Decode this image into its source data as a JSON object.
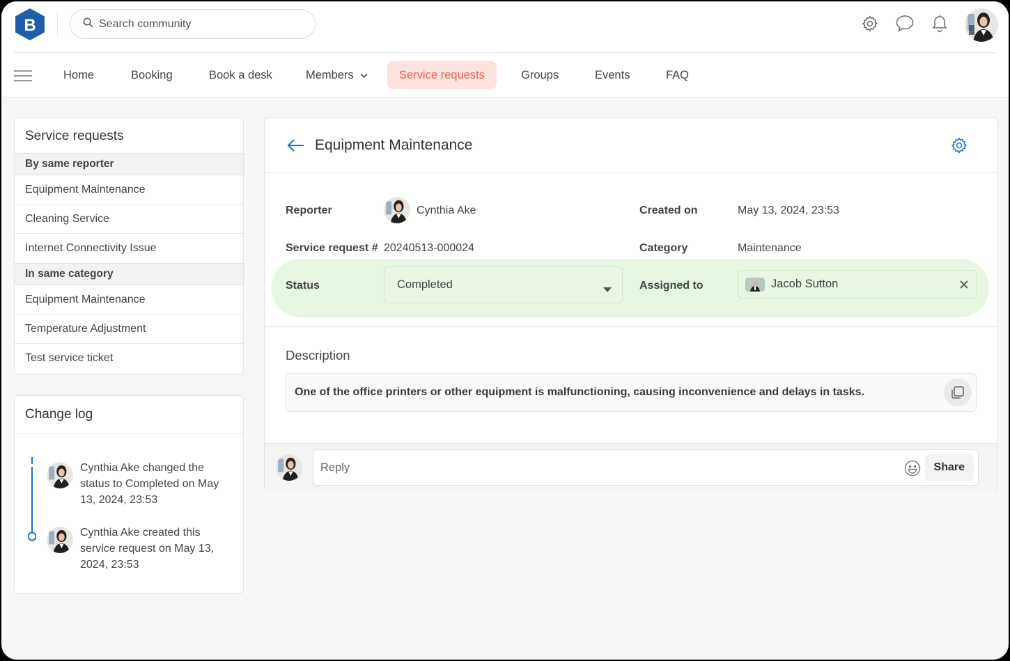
{
  "header": {
    "logo_letter": "B",
    "search_placeholder": "Search community",
    "icons": [
      "gear-icon",
      "chat-icon",
      "bell-icon"
    ]
  },
  "nav": {
    "items": [
      {
        "label": "Home"
      },
      {
        "label": "Booking"
      },
      {
        "label": "Book a desk"
      },
      {
        "label": "Members"
      },
      {
        "label": "Service requests",
        "active": true
      },
      {
        "label": "Groups"
      },
      {
        "label": "Events"
      },
      {
        "label": "FAQ"
      }
    ]
  },
  "sidebar": {
    "title": "Service requests",
    "group1": {
      "header": "By same reporter",
      "items": [
        "Equipment Maintenance",
        "Cleaning Service",
        "Internet Connectivity Issue"
      ]
    },
    "group2": {
      "header": "In same category",
      "items": [
        "Equipment Maintenance",
        "Temperature Adjustment",
        "Test service ticket"
      ]
    }
  },
  "changelog": {
    "title": "Change log",
    "entries": [
      "Cynthia Ake changed the status to Completed on May 13, 2024, 23:53",
      "Cynthia Ake created this service request on May 13, 2024, 23:53"
    ]
  },
  "detail": {
    "title": "Equipment Maintenance",
    "reporter_label": "Reporter",
    "reporter_name": "Cynthia Ake",
    "created_label": "Created on",
    "created_value": "May 13, 2024, 23:53",
    "request_label": "Service request #",
    "request_value": "20240513-000024",
    "category_label": "Category",
    "category_value": "Maintenance",
    "status_label": "Status",
    "status_value": "Completed",
    "assigned_label": "Assigned to",
    "assigned_value": "Jacob Sutton",
    "description_label": "Description",
    "description_text": "One of the office printers or other equipment is malfunctioning, causing inconvenience and delays in tasks."
  },
  "reply": {
    "placeholder": "Reply",
    "share_label": "Share"
  },
  "colors": {
    "brand": "#1e5fa8",
    "active_nav_bg": "#fde2de",
    "active_nav_text": "#e8614f",
    "status_band": "#e7f6e2",
    "timeline": "#1e6fd0"
  }
}
